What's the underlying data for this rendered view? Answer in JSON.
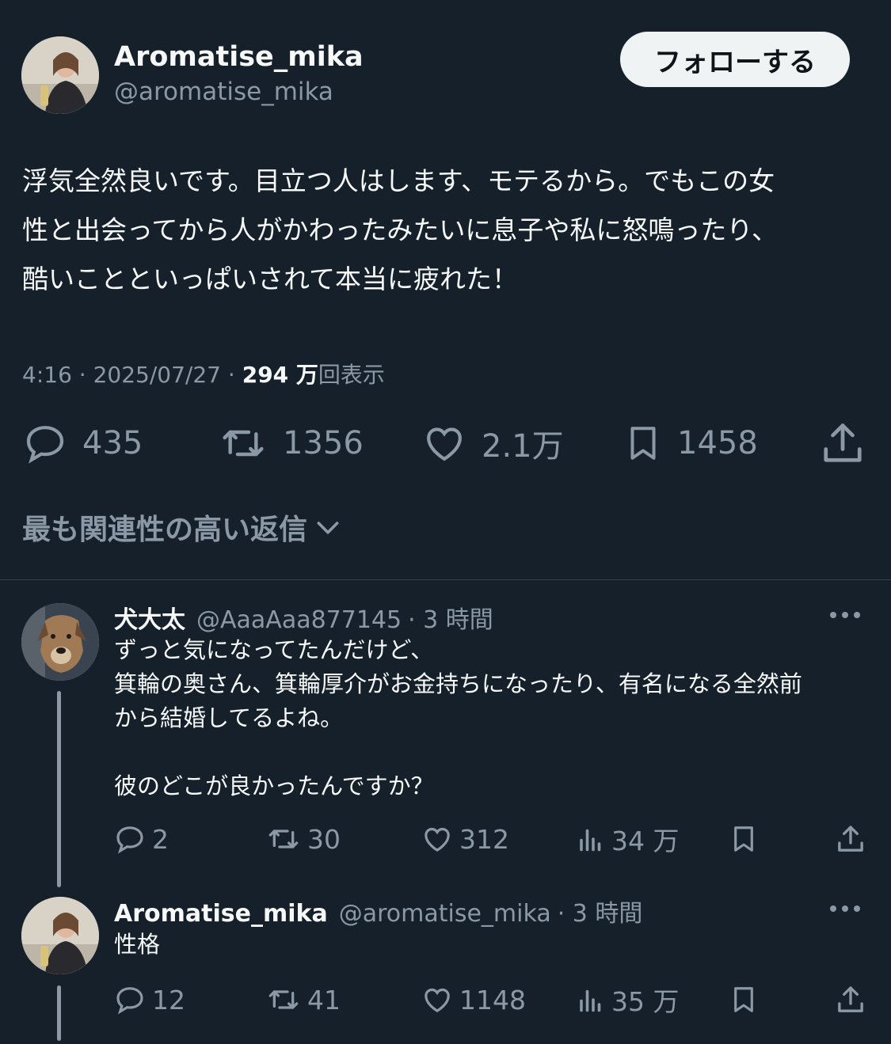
{
  "author": {
    "display_name": "Aromatise_mika",
    "handle": "@aromatise_mika",
    "follow_label": "フォローする"
  },
  "tweet": {
    "text": "浮気全然良いです。目立つ人はします、モテるから。でもこの女\n性と出会ってから人がかわったみたいに息子や私に怒鳴ったり、\n酷いことといっぱいされて本当に疲れた！",
    "time": "4:16",
    "date": "2025/07/27",
    "views_count": "294 万",
    "views_label": "回表示",
    "separator": "·",
    "replies": "435",
    "retweets": "1356",
    "likes": "2.1万",
    "bookmarks": "1458"
  },
  "sort": {
    "label": "最も関連性の高い返信"
  },
  "replies": [
    {
      "display_name": "犬大太",
      "handle": "@AaaAaa877145",
      "time": "· 3 時間",
      "text": "ずっと気になってたんだけど、\n箕輪の奥さん、箕輪厚介がお金持ちになったり、有名になる全然前\nから結婚してるよね。\n\n彼のどこが良かったんですか？",
      "replies": "2",
      "retweets": "30",
      "likes": "312",
      "views": "34 万"
    },
    {
      "display_name": "Aromatise_mika",
      "handle": "@aromatise_mika",
      "time": "· 3 時間",
      "text": "性格",
      "replies": "12",
      "retweets": "41",
      "likes": "1148",
      "views": "35 万"
    }
  ],
  "icons": {
    "reply": "reply-icon",
    "retweet": "retweet-icon",
    "like": "heart-icon",
    "bookmark": "bookmark-icon",
    "share": "share-icon",
    "views": "views-icon",
    "more": "more-icon",
    "chevron": "chevron-down-icon"
  },
  "colors": {
    "background": "#15202b",
    "text": "#f7f9f9",
    "muted": "#8b98a5",
    "button_bg": "#eff3f4"
  }
}
